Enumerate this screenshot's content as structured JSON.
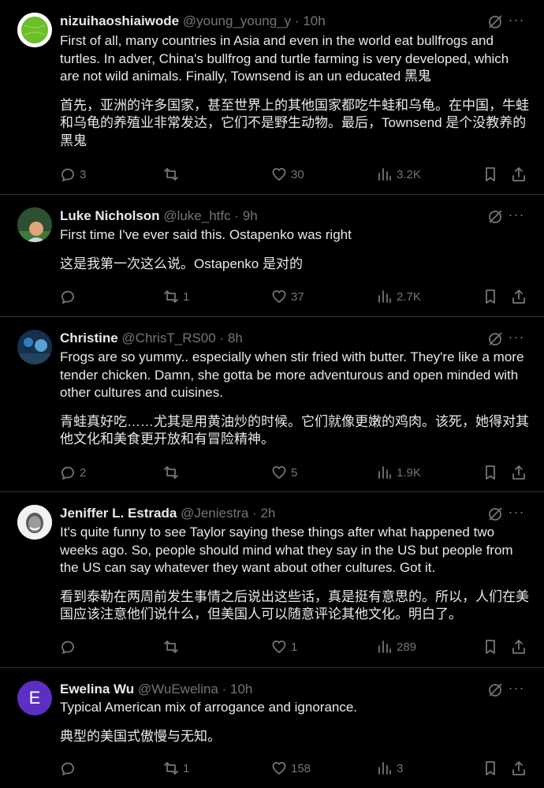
{
  "colors": {
    "background": "#000000",
    "text": "#e7e9ea",
    "muted": "#71767b",
    "divider": "#2f3336",
    "avatar_e": "#5c2fc2"
  },
  "icons": {
    "reply": "reply-icon",
    "repost": "repost-icon",
    "like": "heart-icon",
    "views": "views-icon",
    "bookmark": "bookmark-icon",
    "share": "share-icon",
    "grok": "grok-icon",
    "more": "more-icon"
  },
  "tweets": [
    {
      "name": "nizuihaoshiaiwode",
      "handle": "@young_young_y",
      "time": "10h",
      "text_en": "First of all, many countries in Asia and even in the world eat bullfrogs and turtles. In adver, China's bullfrog and turtle farming is very developed, which are not wild animals. Finally, Townsend is an un educated 黑鬼",
      "text_cn": "首先，亚洲的许多国家，甚至世界上的其他国家都吃牛蛙和乌龟。在中国，牛蛙和乌龟的养殖业非常发达，它们不是野生动物。最后，Townsend 是个没教养的黑鬼",
      "replies": "3",
      "reposts": "",
      "likes": "30",
      "views": "3.2K"
    },
    {
      "name": "Luke Nicholson",
      "handle": "@luke_htfc",
      "time": "9h",
      "text_en": "First time I've ever said this. Ostapenko was right",
      "text_cn": "这是我第一次这么说。Ostapenko 是对的",
      "replies": "",
      "reposts": "1",
      "likes": "37",
      "views": "2.7K"
    },
    {
      "name": "Christine",
      "handle": "@ChrisT_RS00",
      "time": "8h",
      "text_en": "Frogs are so yummy.. especially when stir fried with butter. They're like a more tender chicken. Damn, she gotta be more adventurous and open minded with other cultures and cuisines.",
      "text_cn": "青蛙真好吃……尤其是用黄油炒的时候。它们就像更嫩的鸡肉。该死，她得对其他文化和美食更开放和有冒险精神。",
      "replies": "2",
      "reposts": "",
      "likes": "5",
      "views": "1.9K"
    },
    {
      "name": "Jeniffer L. Estrada",
      "handle": "@Jeniestra",
      "time": "2h",
      "text_en": "It's quite funny to see Taylor saying these things after what happened two weeks ago. So, people should mind what they say in the US but people from the US can say whatever they want about other cultures. Got it.",
      "text_cn": "看到泰勒在两周前发生事情之后说出这些话，真是挺有意思的。所以，人们在美国应该注意他们说什么，但美国人可以随意评论其他文化。明白了。",
      "replies": "",
      "reposts": "",
      "likes": "1",
      "views": "289"
    },
    {
      "name": "Ewelina Wu",
      "handle": "@WuEwelina",
      "time": "10h",
      "text_en": "Typical American mix of arrogance and ignorance.",
      "text_cn": "典型的美国式傲慢与无知。",
      "replies": "",
      "reposts": "1",
      "likes": "158",
      "views": "3",
      "avatar_letter": "E"
    }
  ]
}
